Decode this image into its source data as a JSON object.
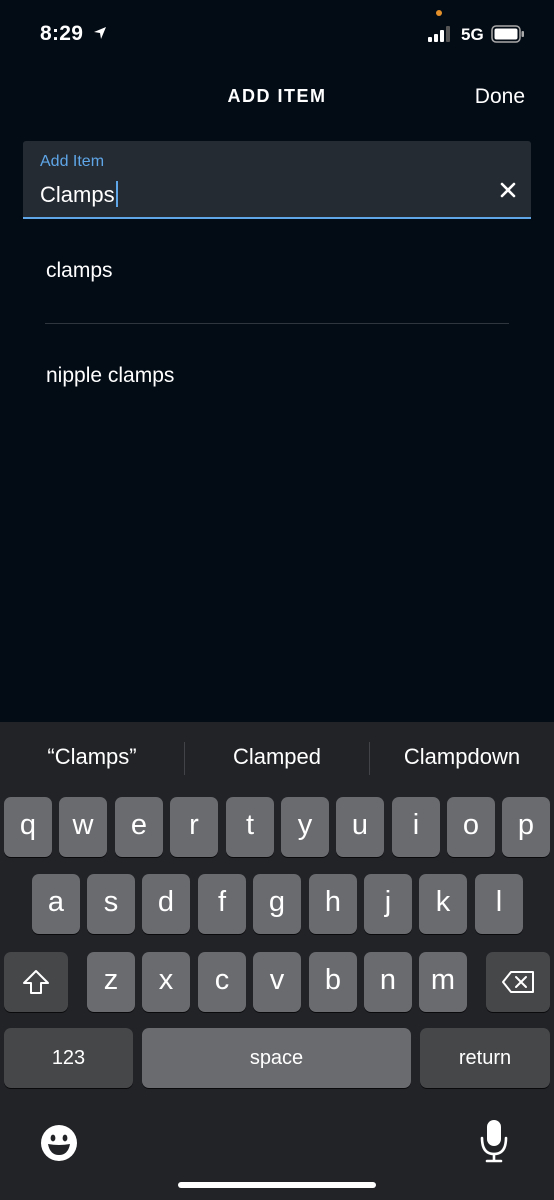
{
  "status_bar": {
    "time": "8:29",
    "network": "5G"
  },
  "nav": {
    "title": "ADD ITEM",
    "done_label": "Done"
  },
  "input": {
    "label": "Add Item",
    "value": "Clamps"
  },
  "suggestions": [
    "clamps",
    "nipple clamps"
  ],
  "keyboard": {
    "predictions": [
      "“Clamps”",
      "Clamped",
      "Clampdown"
    ],
    "row1": [
      "q",
      "w",
      "e",
      "r",
      "t",
      "y",
      "u",
      "i",
      "o",
      "p"
    ],
    "row2": [
      "a",
      "s",
      "d",
      "f",
      "g",
      "h",
      "j",
      "k",
      "l"
    ],
    "row3": [
      "z",
      "x",
      "c",
      "v",
      "b",
      "n",
      "m"
    ],
    "numbers_label": "123",
    "space_label": "space",
    "return_label": "return"
  },
  "colors": {
    "accent": "#5ea6e8",
    "background": "#030b14",
    "keyboard_bg": "#222327",
    "key": "#6a6b6f"
  }
}
